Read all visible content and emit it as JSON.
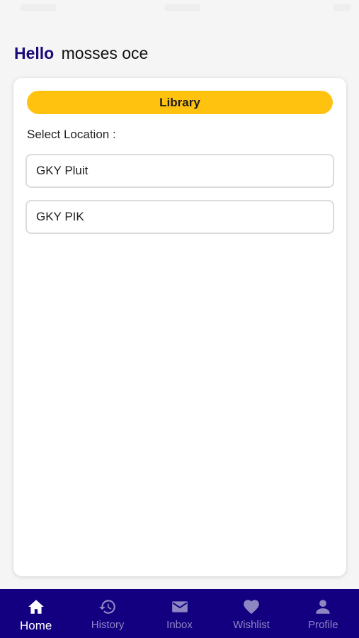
{
  "greeting": {
    "hello": "Hello",
    "name": "mosses oce"
  },
  "card": {
    "title": "Library",
    "select_label": "Select Location :",
    "locations": [
      {
        "label": "GKY Pluit"
      },
      {
        "label": "GKY PIK"
      }
    ]
  },
  "tabbar": {
    "items": [
      {
        "label": "Home",
        "icon": "home-icon",
        "active": true
      },
      {
        "label": "History",
        "icon": "history-icon",
        "active": false
      },
      {
        "label": "Inbox",
        "icon": "mail-icon",
        "active": false
      },
      {
        "label": "Wishlist",
        "icon": "heart-icon",
        "active": false
      },
      {
        "label": "Profile",
        "icon": "person-icon",
        "active": false
      }
    ]
  },
  "colors": {
    "brand_navy": "#130081",
    "accent_yellow": "#ffc20e",
    "hello_text": "#1a0a7a",
    "tab_inactive": "#8c86c3"
  }
}
